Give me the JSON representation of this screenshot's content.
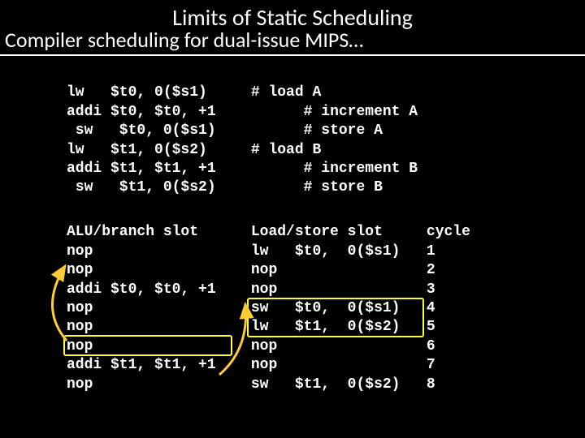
{
  "title": "Limits of Static Scheduling",
  "subtitle": "Compiler scheduling for dual-issue MIPS…",
  "source_code": {
    "lines": [
      {
        "instr": "lw   $t0, 0($s1)",
        "comment": "# load A"
      },
      {
        "instr": "addi $t0, $t0, +1",
        "comment": "       # increment A"
      },
      {
        "instr": " sw   $t0, 0($s1)",
        "comment": "       # store A"
      },
      {
        "instr": "lw   $t1, 0($s2)",
        "comment": "# load B"
      },
      {
        "instr": "addi $t1, $t1, +1",
        "comment": "       # increment B"
      },
      {
        "instr": " sw   $t1, 0($s2)",
        "comment": "       # store B"
      }
    ]
  },
  "schedule": {
    "headers": {
      "alu": "ALU/branch slot",
      "ls": "Load/store slot",
      "cycle": "cycle"
    },
    "rows": [
      {
        "alu": "nop",
        "ls": "lw   $t0,  0($s1)",
        "cycle": "1"
      },
      {
        "alu": "nop",
        "ls": "nop",
        "cycle": "2"
      },
      {
        "alu": "addi $t0, $t0, +1",
        "ls": "nop",
        "cycle": "3"
      },
      {
        "alu": "nop",
        "ls": "sw   $t0,  0($s1)",
        "cycle": "4"
      },
      {
        "alu": "nop",
        "ls": "lw   $t1,  0($s2)",
        "cycle": "5"
      },
      {
        "alu": "nop",
        "ls": "nop",
        "cycle": "6"
      },
      {
        "alu": "addi $t1, $t1, +1",
        "ls": "nop",
        "cycle": "7"
      },
      {
        "alu": "nop",
        "ls": "sw   $t1,  0($s2)",
        "cycle": "8"
      }
    ]
  }
}
